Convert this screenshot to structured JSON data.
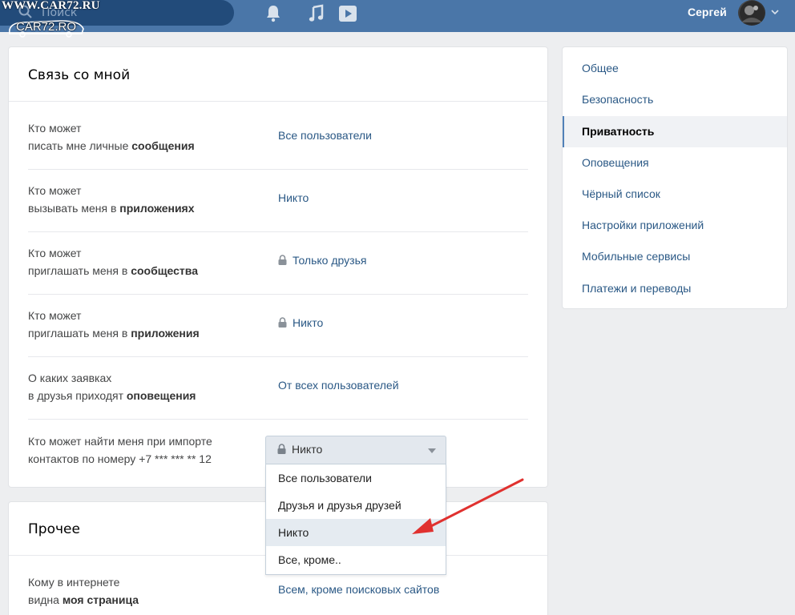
{
  "watermark": {
    "top_text": "WWW.CAR72.RU",
    "logo_text": "CAR72.RO"
  },
  "header": {
    "search_placeholder": "Поиск",
    "user_name": "Сергей"
  },
  "section_contacts": {
    "title": "Связь со мной",
    "rows": [
      {
        "line1": "Кто может",
        "line2_plain": "писать мне личные ",
        "line2_bold": "сообщения",
        "value": "Все пользователи",
        "locked": false
      },
      {
        "line1": "Кто может",
        "line2_plain": "вызывать меня в ",
        "line2_bold": "приложениях",
        "value": "Никто",
        "locked": false
      },
      {
        "line1": "Кто может",
        "line2_plain": "приглашать меня в ",
        "line2_bold": "сообщества",
        "value": "Только друзья",
        "locked": true
      },
      {
        "line1": "Кто может",
        "line2_plain": "приглашать меня в ",
        "line2_bold": "приложения",
        "value": "Никто",
        "locked": true
      },
      {
        "line1": "О каких заявках",
        "line2_plain": "в друзья приходят ",
        "line2_bold": "оповещения",
        "value": "От всех пользователей",
        "locked": false
      }
    ],
    "import_row": {
      "line1": "Кто может найти меня при импорте",
      "line2": "контактов по номеру +7 *** *** ** 12"
    }
  },
  "dropdown": {
    "selected": "Никто",
    "options": [
      "Все пользователи",
      "Друзья и друзья друзей",
      "Никто",
      "Все, кроме.."
    ],
    "highlighted_index": 2
  },
  "section_other": {
    "title": "Прочее",
    "row": {
      "line1": "Кому в интернете",
      "line2_plain": "видна ",
      "line2_bold": "моя страница",
      "value": "Всем, кроме поисковых сайтов"
    }
  },
  "settings_menu": {
    "items": [
      "Общее",
      "Безопасность",
      "Приватность",
      "Оповещения",
      "Чёрный список",
      "Настройки приложений",
      "Мобильные сервисы",
      "Платежи и переводы"
    ],
    "selected_index": 2
  },
  "colors": {
    "topbar": "#4a76a8",
    "link": "#2a5885",
    "arrow": "#e0312f",
    "background": "#edeef0"
  }
}
